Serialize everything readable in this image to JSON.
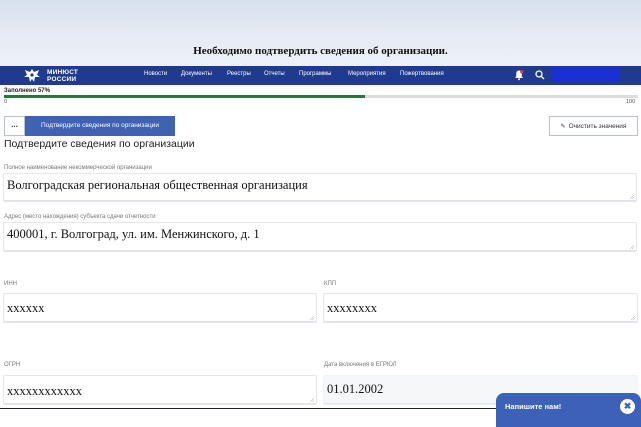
{
  "banner": {
    "text": "Необходимо подтвердить сведения об организации."
  },
  "navbar": {
    "logo_line1": "МИНЮСТ",
    "logo_line2": "РОССИИ",
    "items": [
      "Новости",
      "Документы",
      "Реестры",
      "Отчеты",
      "Программы",
      "Мероприятия",
      "Пожертвования"
    ]
  },
  "progress": {
    "label": "Заполнено 57%",
    "value": 57,
    "min": "0",
    "max": "100"
  },
  "toolbar": {
    "menu_label": "...",
    "confirm_label": "Подтвердите сведения по организации",
    "clear_label": "Очистить значения"
  },
  "section": {
    "title": "Подтвердите сведения по организации"
  },
  "fields": {
    "full_name": {
      "label": "Полное наименование некоммерческой организации",
      "value": "Волгоградская региональная общественная организация"
    },
    "address": {
      "label": "Адрес (место нахождения) субъекта сдачи отчетности",
      "value": "400001, г. Волгоград, ул. им. Менжинского, д. 1"
    },
    "inn": {
      "label": "ИНН",
      "value": "xxxxxx"
    },
    "kpp": {
      "label": "КПП",
      "value": "xxxxxxxx"
    },
    "ogrn": {
      "label": "ОГРН",
      "value": "xxxxxxxxxxxx"
    },
    "egrul_date": {
      "label": "Дата включения в ЕГРЮЛ",
      "value": "01.01.2002"
    }
  },
  "chat": {
    "label": "Напишите нам!"
  },
  "colors": {
    "navbar": "#1f3a8f",
    "primary": "#3f62b3",
    "progress": "#1b7b3c"
  }
}
